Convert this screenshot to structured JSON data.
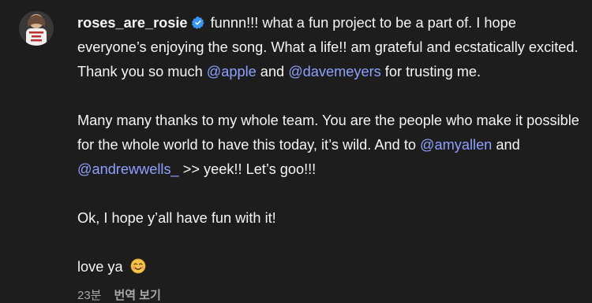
{
  "comment": {
    "username": "roses_are_rosie",
    "avatar_icon": "profile-photo",
    "verified_icon": "verified-badge-icon",
    "paragraph1": {
      "text1": " funnn!!! what a fun project to be a part of. I hope everyone’s enjoying the song. What a life!! am grateful and ecstatically excited. Thank you so much ",
      "mention1": "@apple",
      "text2": " and ",
      "mention2": "@davemeyers",
      "text3": " for trusting me."
    },
    "paragraph2": {
      "text1": "Many many thanks to my whole team. You are the people who make it possible for the whole world to have this today, it’s wild. And to ",
      "mention1": "@amyallen",
      "text2": " and ",
      "mention2": "@andrewwells_",
      "text3": " >> yeek!! Let’s goo!!!"
    },
    "paragraph3": "Ok, I hope y’all have fun with it!",
    "paragraph4": "love ya ",
    "emoji_icon": "smiling-face-icon",
    "time": "23분",
    "translate_label": "번역 보기"
  },
  "colors": {
    "background": "#1d1d1d",
    "text": "#f5f5f5",
    "mention": "#8ea1ff",
    "muted": "#a8a8a8",
    "verified": "#3897f0"
  }
}
